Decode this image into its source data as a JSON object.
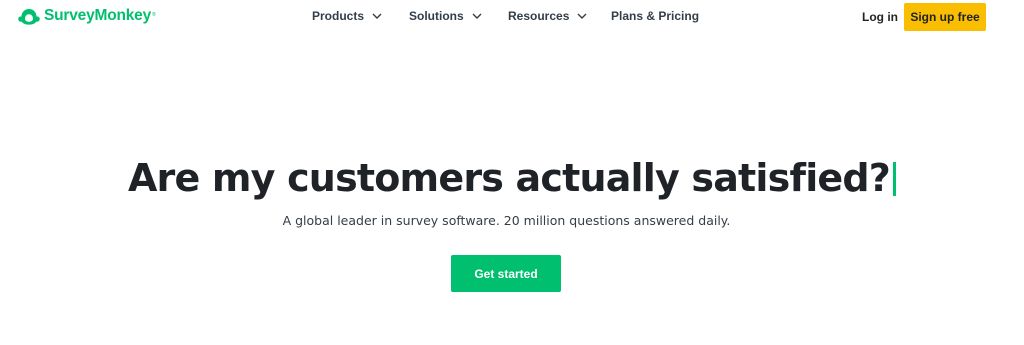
{
  "header": {
    "logo": {
      "text": "SurveyMonkey",
      "tm": "®",
      "icon": "surveymonkey-logo-icon",
      "color": "#00bf6f"
    },
    "nav": [
      {
        "label": "Products",
        "icon": "chevron-down-icon"
      },
      {
        "label": "Solutions",
        "icon": "chevron-down-icon"
      },
      {
        "label": "Resources",
        "icon": "chevron-down-icon"
      },
      {
        "label": "Plans & Pricing"
      }
    ],
    "login_label": "Log in",
    "signup_label": "Sign up free",
    "signup_color": "#f9be00"
  },
  "hero": {
    "title": "Are my customers actually satisfied?",
    "cursor_color": "#00bf6f",
    "subtitle": "A global leader in survey software. 20 million questions answered daily.",
    "cta_label": "Get started",
    "cta_color": "#00bf6f"
  }
}
